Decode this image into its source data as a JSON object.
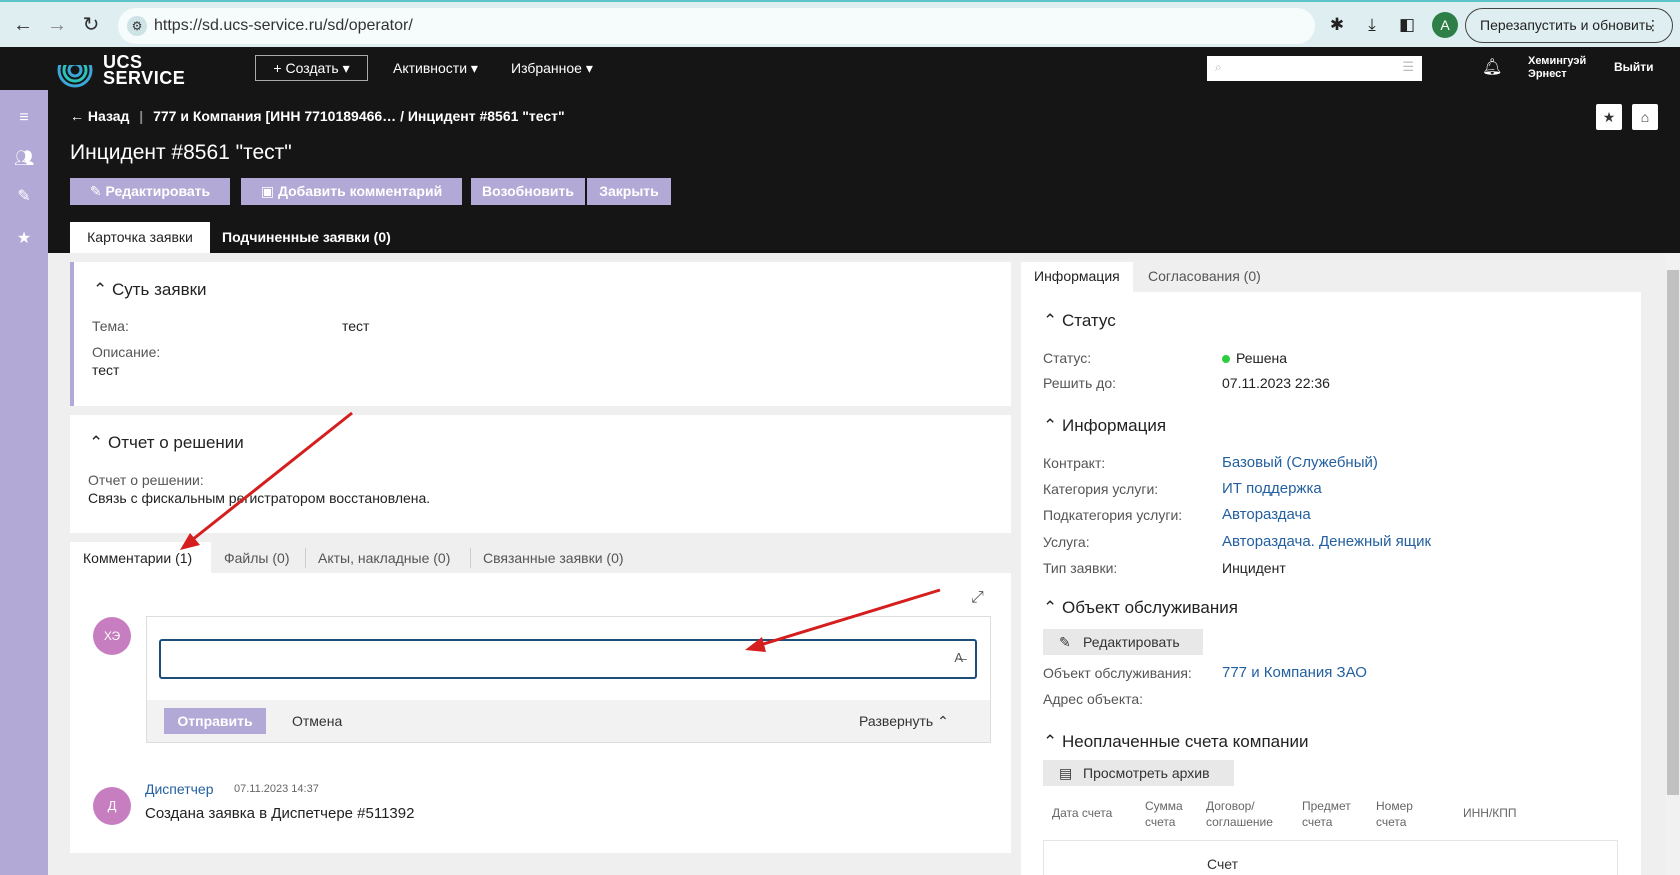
{
  "browser": {
    "url": "https://sd.ucs-service.ru/sd/operator/",
    "relaunch_label": "Перезапустить и обновить",
    "profile_initial": "A"
  },
  "header": {
    "logo_line1": "UCS",
    "logo_line2": "SERVICE",
    "create_label": "+ Создать ▾",
    "menu_activities": "Активности ▾",
    "menu_favorites": "Избранное ▾",
    "user_line1": "Хемингуэй",
    "user_line2": "Эрнест",
    "logout_label": "Выйти"
  },
  "breadcrumb": {
    "back_label": "← Назад",
    "path": "777 и Компания [ИНН 7710189466… / Инцидент #8561 \"тест\""
  },
  "page_title": "Инцидент #8561 \"тест\"",
  "actions": {
    "edit": "Редактировать",
    "add_comment": "Добавить комментарий",
    "reopen": "Возобновить",
    "close": "Закрыть"
  },
  "tabs": {
    "card": "Карточка заявки",
    "sub": "Подчиненные заявки (0)"
  },
  "essence": {
    "title": "Суть заявки",
    "subject_label": "Тема:",
    "subject_value": "тест",
    "description_label": "Описание:",
    "description_value": "тест"
  },
  "report": {
    "title": "Отчет о решении",
    "label": "Отчет о решении:",
    "value": "Связь с фискальным регистратором восстановлена."
  },
  "lower_tabs": {
    "comments": "Комментарии (1)",
    "files": "Файлы (0)",
    "acts": "Акты, накладные (0)",
    "linked": "Связанные заявки (0)"
  },
  "comment_form": {
    "avatar": "ХЭ",
    "send_label": "Отправить",
    "cancel_label": "Отмена",
    "expand_label": "Развернуть"
  },
  "comment": {
    "avatar": "Д",
    "author": "Диспетчер",
    "date": "07.11.2023 14:37",
    "text": "Создана заявка в Диспетчере #511392"
  },
  "right_tabs": {
    "info": "Информация",
    "approvals": "Согласования (0)"
  },
  "status": {
    "title": "Статус",
    "status_label": "Статус:",
    "status_value": "Решена",
    "due_label": "Решить до:",
    "due_value": "07.11.2023 22:36",
    "status_color": "#2ecc40"
  },
  "info": {
    "title": "Информация",
    "contract_label": "Контракт:",
    "contract_value": "Базовый (Служебный)",
    "category_label": "Категория услуги:",
    "category_value": "ИТ поддержка",
    "subcategory_label": "Подкатегория услуги:",
    "subcategory_value": "Автораздача",
    "service_label": "Услуга:",
    "service_value": "Автораздача. Денежный ящик",
    "type_label": "Тип заявки:",
    "type_value": "Инцидент"
  },
  "object": {
    "title": "Объект обслуживания",
    "edit_label": "Редактировать",
    "object_label": "Объект обслуживания:",
    "object_value": "777 и Компания ЗАО",
    "address_label": "Адрес объекта:"
  },
  "invoices": {
    "title": "Неоплаченные счета компании",
    "archive_label": "Просмотреть архив",
    "col_date": "Дата счета",
    "col_sum1": "Сумма",
    "col_sum2": "счета",
    "col_contract1": "Договор/",
    "col_contract2": "соглашение",
    "col_subject1": "Предмет",
    "col_subject2": "счета",
    "col_number1": "Номер",
    "col_number2": "счета",
    "col_inn": "ИНН/КПП",
    "row_partial": "Счет"
  }
}
